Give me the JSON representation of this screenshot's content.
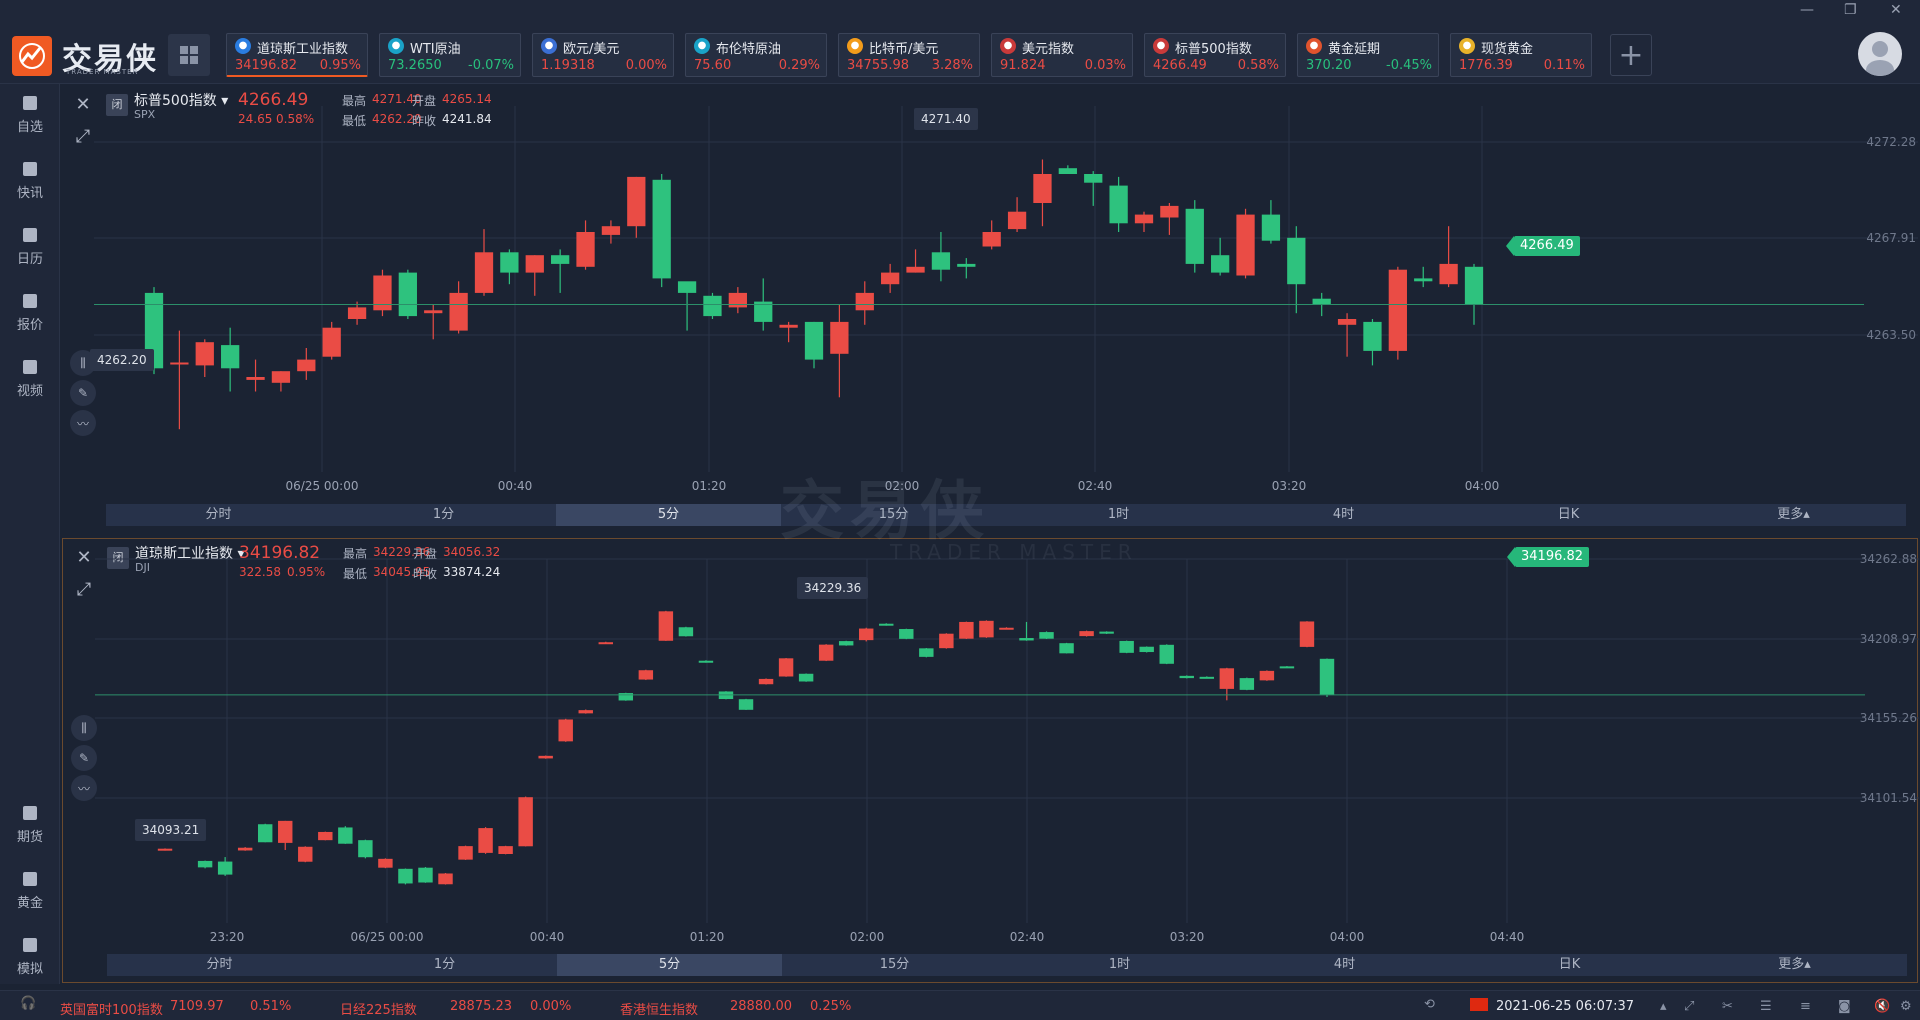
{
  "app": {
    "logo_text": "交易侠",
    "logo_sub": "TRADER MASTER",
    "watermark": "交易侠",
    "watermark_sub": "TRADER MASTER"
  },
  "tickers": [
    {
      "name": "道琼斯工业指数",
      "price": "34196.82",
      "change": "0.95%",
      "dir": "up",
      "icon": "dow-icon",
      "color": "#2a7de1",
      "active": true
    },
    {
      "name": "WTI原油",
      "price": "73.2650",
      "change": "-0.07%",
      "dir": "dn",
      "icon": "oil-icon",
      "color": "#1aa3c8",
      "active": false
    },
    {
      "name": "欧元/美元",
      "price": "1.19318",
      "change": "0.00%",
      "dir": "up",
      "icon": "eu-flag-icon",
      "color": "#3b6fd4",
      "active": false
    },
    {
      "name": "布伦特原油",
      "price": "75.60",
      "change": "0.29%",
      "dir": "up",
      "icon": "oil-icon",
      "color": "#1aa3c8",
      "active": false
    },
    {
      "name": "比特币/美元",
      "price": "34755.98",
      "change": "3.28%",
      "dir": "up",
      "icon": "bitcoin-icon",
      "color": "#f39c1b",
      "active": false
    },
    {
      "name": "美元指数",
      "price": "91.824",
      "change": "0.03%",
      "dir": "up",
      "icon": "us-flag-icon",
      "color": "#c93a3a",
      "active": false
    },
    {
      "name": "标普500指数",
      "price": "4266.49",
      "change": "0.58%",
      "dir": "up",
      "icon": "us-flag-icon",
      "color": "#c93a3a",
      "active": false
    },
    {
      "name": "黄金延期",
      "price": "370.20",
      "change": "-0.45%",
      "dir": "dn",
      "icon": "gold-icon",
      "color": "#e0532d",
      "active": false
    },
    {
      "name": "现货黄金",
      "price": "1776.39",
      "change": "0.11%",
      "dir": "up",
      "icon": "gold-coin-icon",
      "color": "#e8b22a",
      "active": false
    }
  ],
  "sidebar": {
    "items": [
      "自选",
      "快讯",
      "日历",
      "报价",
      "视频"
    ],
    "bottom": [
      "期货",
      "黄金",
      "模拟"
    ]
  },
  "panel1": {
    "name": "标普500指数",
    "code": "SPX",
    "closed": "闭",
    "price": "4266.49",
    "chg": "24.65",
    "pct": "0.58%",
    "high_label": "最高",
    "high": "4271.40",
    "low_label": "最低",
    "low": "4262.20",
    "open_label": "开盘",
    "open": "4265.14",
    "prev_label": "昨收",
    "prev": "4241.84",
    "current_tag": "4266.49",
    "max_callout": "4271.40",
    "min_callout": "4262.20",
    "y_ticks": [
      "4272.28",
      "4267.91",
      "4263.50"
    ],
    "x_ticks": [
      "06/25 00:00",
      "00:40",
      "01:20",
      "02:00",
      "02:40",
      "03:20",
      "04:00"
    ]
  },
  "panel2": {
    "name": "道琼斯工业指数",
    "code": "DJI",
    "closed": "闭",
    "price": "34196.82",
    "chg": "322.58",
    "pct": "0.95%",
    "high_label": "最高",
    "high": "34229.36",
    "low_label": "最低",
    "low": "34045.95",
    "open_label": "开盘",
    "open": "34056.32",
    "prev_label": "昨收",
    "prev": "33874.24",
    "current_tag": "34196.82",
    "max_callout": "34229.36",
    "min_callout": "34093.21",
    "y_ticks": [
      "34262.88",
      "34208.97",
      "34155.26",
      "34101.54"
    ],
    "x_ticks": [
      "23:20",
      "06/25 00:00",
      "00:40",
      "01:20",
      "02:00",
      "02:40",
      "03:20",
      "04:00",
      "04:40"
    ]
  },
  "timeframes": [
    "分时",
    "1分",
    "5分",
    "15分",
    "1时",
    "4时",
    "日K",
    "更多▴"
  ],
  "selected_timeframe": "5分",
  "footer": [
    {
      "name": "英国富时100指数",
      "value": "7109.97",
      "pct": "0.51%"
    },
    {
      "name": "日经225指数",
      "value": "28875.23",
      "pct": "0.00%"
    },
    {
      "name": "香港恒生指数",
      "value": "28880.00",
      "pct": "0.25%"
    }
  ],
  "datetime": "2021-06-25 06:07:37",
  "chart_data": [
    {
      "type": "candlestick",
      "title": "标普500指数",
      "ylim": [
        4261.0,
        4273.0
      ],
      "candles": [
        [
          4266.9,
          4264.3,
          4267.1,
          4264.1
        ],
        [
          4264.5,
          4264.5,
          4265.6,
          4262.2
        ],
        [
          4264.4,
          4265.2,
          4265.3,
          4264.0
        ],
        [
          4265.1,
          4264.3,
          4265.7,
          4263.5
        ],
        [
          4263.9,
          4264.0,
          4264.6,
          4263.5
        ],
        [
          4263.8,
          4264.2,
          4264.2,
          4263.5
        ],
        [
          4264.2,
          4264.6,
          4265.0,
          4263.9
        ],
        [
          4264.7,
          4265.7,
          4265.9,
          4264.6
        ],
        [
          4266.0,
          4266.4,
          4266.6,
          4265.8
        ],
        [
          4266.3,
          4267.5,
          4267.7,
          4266.1
        ],
        [
          4267.6,
          4266.1,
          4267.7,
          4266.0
        ],
        [
          4266.2,
          4266.3,
          4266.5,
          4265.3
        ],
        [
          4265.6,
          4266.9,
          4267.3,
          4265.5
        ],
        [
          4266.9,
          4268.3,
          4269.1,
          4266.8
        ],
        [
          4268.3,
          4267.6,
          4268.4,
          4267.2
        ],
        [
          4267.6,
          4268.2,
          4268.2,
          4266.8
        ],
        [
          4268.2,
          4267.9,
          4268.4,
          4266.9
        ],
        [
          4267.8,
          4269.0,
          4269.4,
          4267.7
        ],
        [
          4268.9,
          4269.2,
          4269.4,
          4268.6
        ],
        [
          4269.2,
          4270.9,
          4270.9,
          4268.8
        ],
        [
          4270.8,
          4267.4,
          4271.0,
          4267.1
        ],
        [
          4267.3,
          4266.9,
          4267.1,
          4265.6
        ],
        [
          4266.8,
          4266.1,
          4266.9,
          4266.0
        ],
        [
          4266.4,
          4266.9,
          4267.1,
          4266.2
        ],
        [
          4266.6,
          4265.9,
          4267.4,
          4265.6
        ],
        [
          4265.7,
          4265.8,
          4265.9,
          4265.2
        ],
        [
          4265.9,
          4264.6,
          4265.9,
          4264.3
        ],
        [
          4264.8,
          4265.9,
          4266.5,
          4263.3
        ],
        [
          4266.3,
          4266.9,
          4267.3,
          4265.8
        ],
        [
          4267.2,
          4267.6,
          4267.9,
          4266.9
        ],
        [
          4267.6,
          4267.8,
          4268.4,
          4267.6
        ],
        [
          4268.3,
          4267.7,
          4269.0,
          4267.3
        ],
        [
          4267.9,
          4267.8,
          4268.1,
          4267.4
        ],
        [
          4268.5,
          4269.0,
          4269.4,
          4268.4
        ],
        [
          4269.1,
          4269.7,
          4270.2,
          4269.0
        ],
        [
          4270.0,
          4271.0,
          4271.5,
          4269.2
        ],
        [
          4271.2,
          4271.0,
          4271.3,
          4271.0
        ],
        [
          4271.0,
          4270.7,
          4271.1,
          4269.9
        ],
        [
          4270.6,
          4269.3,
          4270.9,
          4269.0
        ],
        [
          4269.3,
          4269.6,
          4269.7,
          4269.0
        ],
        [
          4269.5,
          4269.9,
          4270.0,
          4268.9
        ],
        [
          4269.8,
          4267.9,
          4270.1,
          4267.6
        ],
        [
          4268.2,
          4267.6,
          4268.8,
          4267.5
        ],
        [
          4267.5,
          4269.6,
          4269.8,
          4267.4
        ],
        [
          4269.6,
          4268.7,
          4270.1,
          4268.6
        ],
        [
          4268.8,
          4267.2,
          4269.2,
          4266.2
        ],
        [
          4266.7,
          4266.5,
          4266.9,
          4266.1
        ],
        [
          4265.8,
          4266.0,
          4266.2,
          4264.7
        ],
        [
          4265.9,
          4264.9,
          4266.0,
          4264.4
        ],
        [
          4264.9,
          4267.7,
          4267.8,
          4264.6
        ],
        [
          4267.4,
          4267.3,
          4267.8,
          4267.1
        ],
        [
          4267.2,
          4267.9,
          4269.2,
          4267.1
        ],
        [
          4267.8,
          4266.5,
          4267.9,
          4265.8
        ]
      ]
    },
    {
      "type": "candlestick",
      "title": "道琼斯工业指数",
      "ylim": [
        34060,
        34275
      ],
      "candles": [
        [
          34108.9,
          34108.1,
          34109.5,
          34107.5
        ],
        [
          34100.4,
          34101.2,
          34101.4,
          34100.0
        ],
        [
          34109.1,
          34113.0,
          34115.6,
          34108.1
        ],
        [
          34093.6,
          34089.6,
          34093.8,
          34089.0
        ],
        [
          34093.2,
          34085.1,
          34096.0,
          34084.3
        ],
        [
          34100.1,
          34101.8,
          34102.2,
          34099.9
        ],
        [
          34116.4,
          34105.2,
          34116.7,
          34105.2
        ],
        [
          34104.8,
          34118.5,
          34118.5,
          34100.4
        ],
        [
          34093.1,
          34102.4,
          34102.7,
          34092.8
        ],
        [
          34106.5,
          34111.6,
          34111.8,
          34106.4
        ],
        [
          34114.4,
          34104.3,
          34115.2,
          34104.2
        ],
        [
          34106.5,
          34095.9,
          34106.8,
          34095.2
        ],
        [
          34089.4,
          34094.9,
          34095.2,
          34089.1
        ],
        [
          34088.7,
          34079.6,
          34088.9,
          34079.0
        ],
        [
          34089.4,
          34080.2,
          34089.8,
          34080.0
        ],
        [
          34079.1,
          34085.8,
          34086.1,
          34078.9
        ],
        [
          34094.4,
          34102.8,
          34103.1,
          34094.2
        ],
        [
          34098.6,
          34114.0,
          34114.6,
          34098.0
        ],
        [
          34097.9,
          34102.8,
          34103.0,
          34097.7
        ],
        [
          34102.7,
          34133.2,
          34133.6,
          34102.6
        ],
        [
          34157.3,
          34158.9,
          34159.1,
          34157.1
        ],
        [
          34167.9,
          34181.5,
          34181.9,
          34167.6
        ],
        [
          34185.3,
          34187.3,
          34187.7,
          34185.1
        ],
        [
          34229.0,
          34229.5,
          34229.8,
          34228.8
        ],
        [
          34197.9,
          34193.3,
          34198.1,
          34193.1
        ],
        [
          34206.3,
          34212.1,
          34212.4,
          34206.0
        ],
        [
          34230.4,
          34248.7,
          34249.0,
          34230.3
        ],
        [
          34238.8,
          34233.2,
          34239.1,
          34233.0
        ],
        [
          34218.0,
          34217.1,
          34218.3,
          34216.8
        ],
        [
          34198.9,
          34194.2,
          34199.1,
          34194.0
        ],
        [
          34194.1,
          34187.5,
          34194.3,
          34187.4
        ],
        [
          34203.4,
          34206.7,
          34207.0,
          34203.2
        ],
        [
          34208.2,
          34219.5,
          34219.7,
          34208.0
        ],
        [
          34209.9,
          34205.1,
          34210.1,
          34204.9
        ],
        [
          34218.0,
          34228.0,
          34228.3,
          34217.8
        ],
        [
          34230.2,
          34227.5,
          34230.4,
          34227.3
        ],
        [
          34230.8,
          34238.0,
          34238.5,
          34230.0
        ],
        [
          34241.0,
          34240.1,
          34241.3,
          34239.8
        ],
        [
          34237.7,
          34231.6,
          34237.9,
          34231.4
        ],
        [
          34225.7,
          34220.4,
          34225.9,
          34220.1
        ],
        [
          34225.8,
          34234.8,
          34235.1,
          34225.5
        ],
        [
          34231.7,
          34242.1,
          34242.3,
          34231.5
        ],
        [
          34232.5,
          34242.8,
          34243.1,
          34232.2
        ],
        [
          34238.1,
          34238.5,
          34238.8,
          34238.0
        ],
        [
          34232.1,
          34230.6,
          34242.1,
          34230.4
        ],
        [
          34235.8,
          34231.7,
          34236.2,
          34231.5
        ],
        [
          34228.9,
          34222.6,
          34229.1,
          34222.5
        ],
        [
          34233.3,
          34236.4,
          34236.7,
          34233.0
        ],
        [
          34236.1,
          34234.8,
          34236.3,
          34234.6
        ],
        [
          34230.3,
          34222.9,
          34230.5,
          34222.7
        ],
        [
          34226.7,
          34223.4,
          34226.9,
          34223.1
        ],
        [
          34227.9,
          34216.1,
          34228.2,
          34215.9
        ],
        [
          34208.6,
          34207.2,
          34208.9,
          34207.0
        ],
        [
          34208.0,
          34207.8,
          34208.3,
          34207.5
        ],
        [
          34200.5,
          34213.3,
          34213.6,
          34193.4
        ],
        [
          34207.2,
          34199.9,
          34207.5,
          34199.7
        ],
        [
          34205.8,
          34211.7,
          34212.0,
          34205.5
        ],
        [
          34214.5,
          34214.0,
          34214.7,
          34213.8
        ],
        [
          34226.6,
          34242.4,
          34242.6,
          34226.4
        ],
        [
          34219.2,
          34196.8,
          34219.4,
          34195.5
        ]
      ]
    }
  ]
}
